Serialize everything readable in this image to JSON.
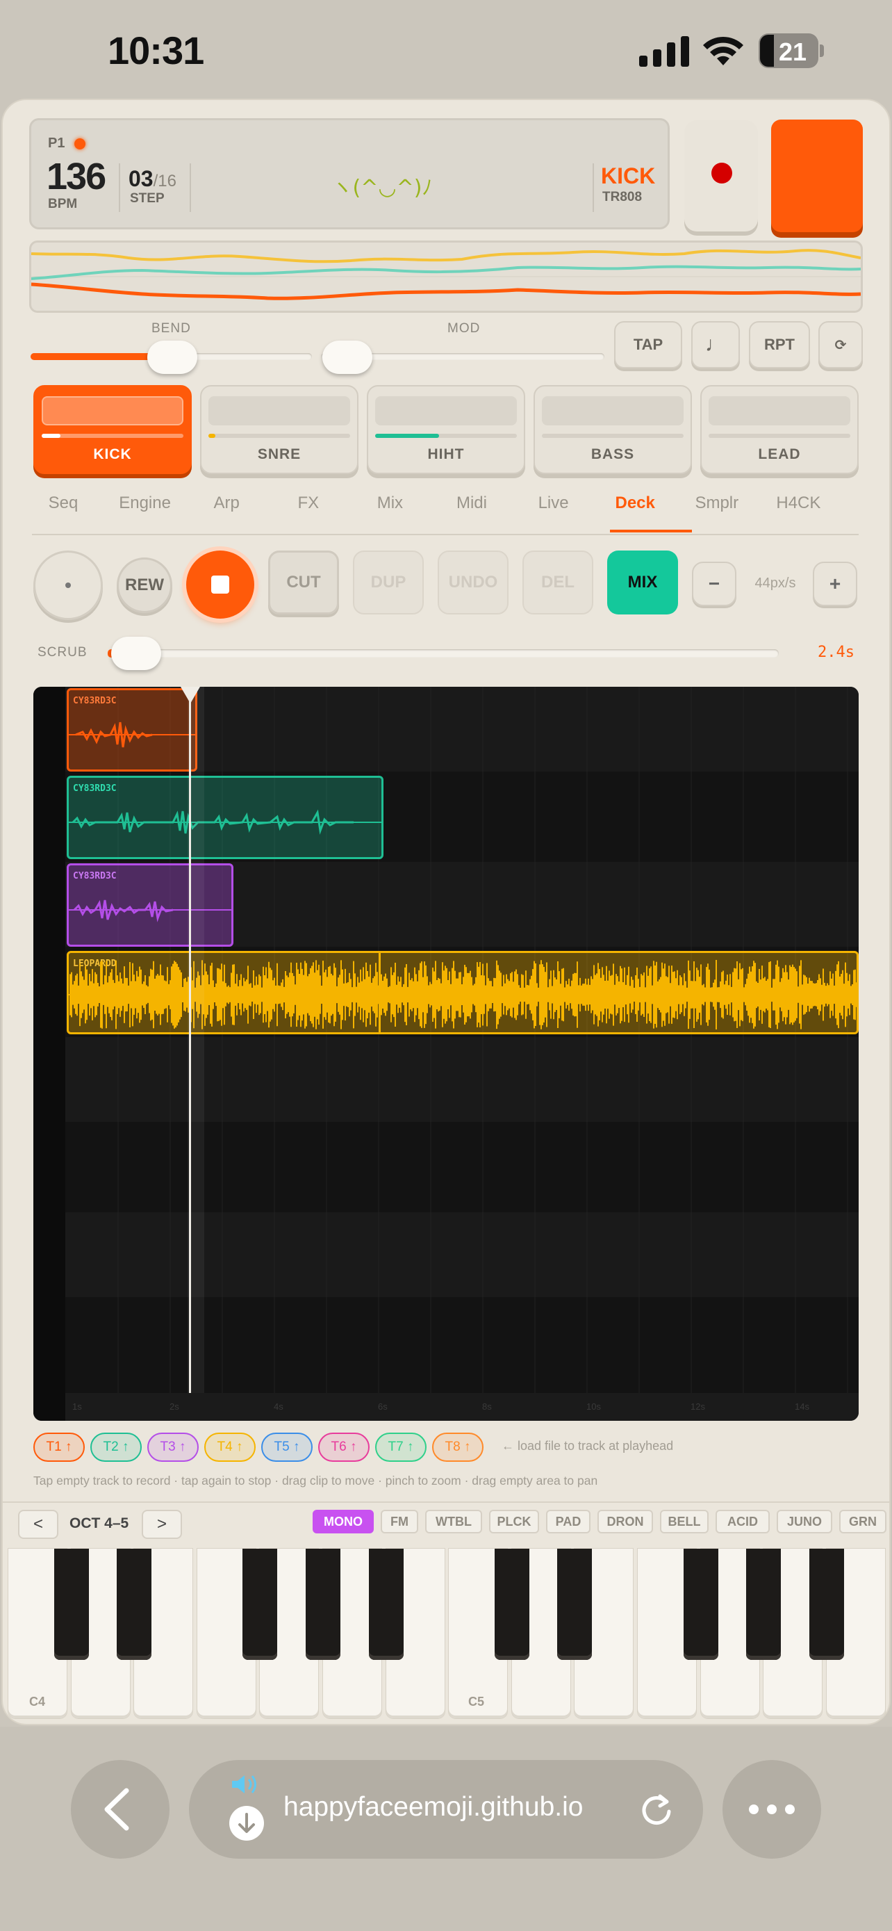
{
  "status": {
    "time": "10:31",
    "battery": "21"
  },
  "lcd": {
    "pattern": "P1",
    "bpm": "136",
    "bpm_label": "BPM",
    "step": "03",
    "step_total": "/16",
    "step_label": "STEP",
    "face": "ヽ(^◡^)ﾉ",
    "instrument": "KICK",
    "machine": "TR808"
  },
  "sliders": {
    "bend_label": "BEND",
    "mod_label": "MOD"
  },
  "buttons": {
    "tap": "TAP",
    "note": "♩",
    "rpt": "RPT",
    "loop": "⟳"
  },
  "tracks": [
    {
      "name": "KICK",
      "level": 0.13,
      "color": "#ffffff",
      "active": true
    },
    {
      "name": "SNRE",
      "level": 0.05,
      "color": "#f5b400"
    },
    {
      "name": "HIHT",
      "level": 0.45,
      "color": "#1fbf94"
    },
    {
      "name": "BASS",
      "level": 0,
      "color": "#d6d0c6"
    },
    {
      "name": "LEAD",
      "level": 0,
      "color": "#d6d0c6"
    }
  ],
  "tabs": [
    "Seq",
    "Engine",
    "Arp",
    "FX",
    "Mix",
    "Midi",
    "Live",
    "Deck",
    "Smplr",
    "H4CK"
  ],
  "active_tab": "Deck",
  "deck": {
    "rew": "REW",
    "cut": "CUT",
    "dup": "DUP",
    "undo": "UNDO",
    "del": "DEL",
    "mix": "MIX",
    "minus": "−",
    "plus": "+",
    "zoom": "44px/s",
    "scrub_label": "SCRUB",
    "scrub_time": "2.4s",
    "clips": [
      {
        "name": "CY83RD3C",
        "color": "#ff5a0a"
      },
      {
        "name": "CY83RD3C",
        "color": "#1fbf94"
      },
      {
        "name": "CY83RD3C",
        "color": "#b44ee8"
      },
      {
        "name": "LEOPARDD",
        "color": "#f5b400"
      }
    ],
    "ruler": [
      "1s",
      "2s",
      "4s",
      "6s",
      "8s",
      "10s",
      "12s",
      "14s"
    ]
  },
  "chips": [
    {
      "label": "T1 ↑",
      "color": "#ff5a0a"
    },
    {
      "label": "T2 ↑",
      "color": "#1fbf94"
    },
    {
      "label": "T3 ↑",
      "color": "#b44ee8"
    },
    {
      "label": "T4 ↑",
      "color": "#f5b400"
    },
    {
      "label": "T5 ↑",
      "color": "#3b8ee8"
    },
    {
      "label": "T6 ↑",
      "color": "#e83c9c"
    },
    {
      "label": "T7 ↑",
      "color": "#2fd08a"
    },
    {
      "label": "T8 ↑",
      "color": "#ff8a2a"
    }
  ],
  "hint_load": "← load file to track at playhead",
  "hint_help": "Tap empty track to record · tap again to stop · drag clip to move · pinch to zoom · drag empty area to pan",
  "keyboard": {
    "prev": "<",
    "next": ">",
    "octave": "OCT 4–5",
    "synths": [
      "MONO",
      "FM",
      "WTBL",
      "PLCK",
      "PAD",
      "DRON",
      "BELL",
      "ACID",
      "JUNO",
      "GRN"
    ],
    "active_synth": "MONO",
    "c4": "C4",
    "c5": "C5"
  },
  "browser": {
    "url": "happyfaceemoji.github.io"
  }
}
